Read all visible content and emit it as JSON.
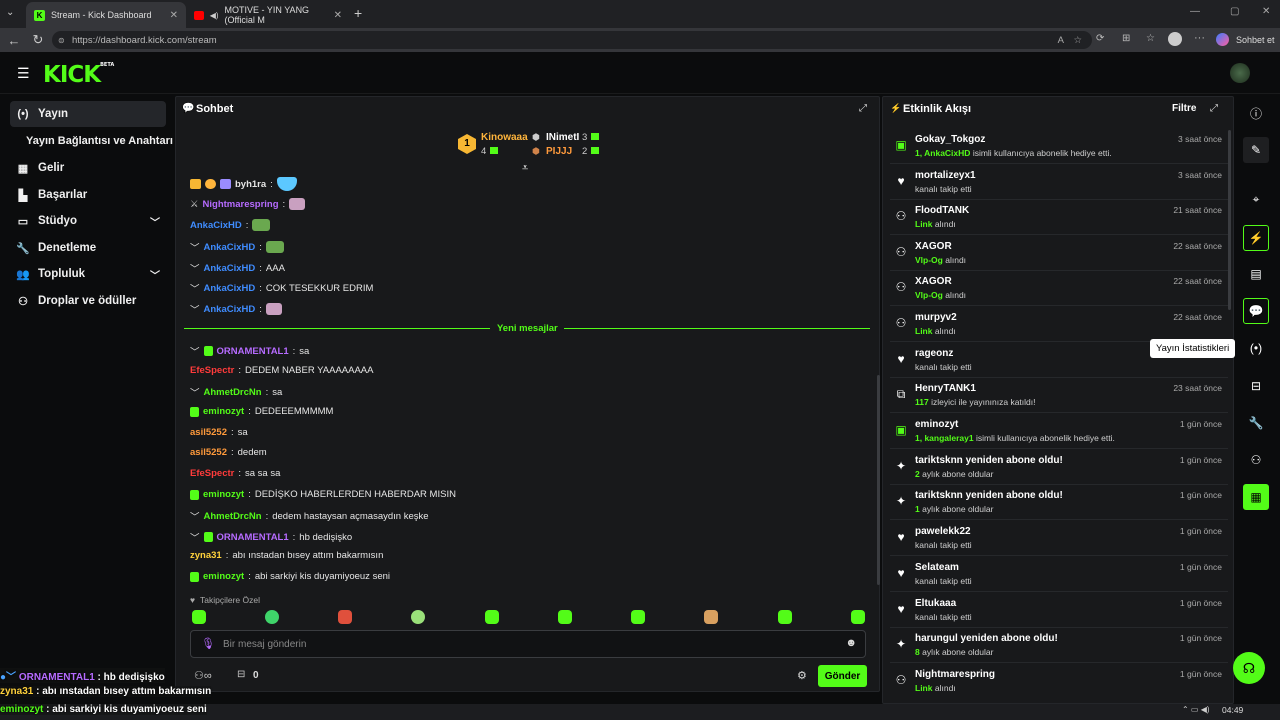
{
  "browser": {
    "tabs": [
      {
        "title": "Stream - Kick Dashboard"
      },
      {
        "title": "MOTIVE - YIN YANG (Official M"
      }
    ],
    "url": "https://dashboard.kick.com/stream",
    "copilot_label": "Sohbet et"
  },
  "app": {
    "logo": "KICK",
    "logo_badge": "BETA"
  },
  "sidebar": {
    "items": [
      {
        "label": "Yayın",
        "icon": "broadcast-icon"
      },
      {
        "label": "Yayın Bağlantısı ve Anahtarı",
        "icon": ""
      },
      {
        "label": "Gelir",
        "icon": "revenue-icon"
      },
      {
        "label": "Başarılar",
        "icon": "achievements-icon"
      },
      {
        "label": "Stüdyo",
        "icon": "studio-icon"
      },
      {
        "label": "Denetleme",
        "icon": "moderation-icon"
      },
      {
        "label": "Topluluk",
        "icon": "community-icon"
      },
      {
        "label": "Droplar ve ödüller",
        "icon": "drops-icon"
      }
    ]
  },
  "chat": {
    "title": "Sohbet",
    "leaderboard": [
      {
        "rank": "1",
        "name": "Kinowaaa",
        "count": "4"
      },
      {
        "name": "INimetI",
        "count": "3"
      },
      {
        "name": "PIJJJ",
        "count": "2"
      }
    ],
    "messages_old": [
      {
        "user": "byh1ra",
        "text": "",
        "color": "#e6e6e6"
      },
      {
        "user": "Nightmarespring",
        "text": "",
        "color": "#b66bff"
      },
      {
        "user": "AnkaCixHD",
        "text": "",
        "color": "#3f8cff"
      },
      {
        "user": "AnkaCixHD",
        "text": "",
        "color": "#3f8cff"
      },
      {
        "user": "AnkaCixHD",
        "text": "AAA",
        "color": "#3f8cff"
      },
      {
        "user": "AnkaCixHD",
        "text": "COK TESEKKUR EDRIM",
        "color": "#3f8cff"
      },
      {
        "user": "AnkaCixHD",
        "text": "",
        "color": "#3f8cff"
      }
    ],
    "new_messages_label": "Yeni mesajlar",
    "messages_new": [
      {
        "user": "ORNAMENTAL1",
        "text": "sa",
        "color": "#b66bff"
      },
      {
        "user": "EfeSpectr",
        "text": "DEDEM NABER YAAAAAAAA",
        "color": "#ff3b3b"
      },
      {
        "user": "AhmetDrcNn",
        "text": "sa",
        "color": "#53fc18"
      },
      {
        "user": "eminozyt",
        "text": "DEDEEEMMMMM",
        "color": "#53fc18"
      },
      {
        "user": "asil5252",
        "text": "sa",
        "color": "#ff9a3c"
      },
      {
        "user": "asil5252",
        "text": "dedem",
        "color": "#ff9a3c"
      },
      {
        "user": "EfeSpectr",
        "text": "sa sa sa",
        "color": "#ff3b3b"
      },
      {
        "user": "eminozyt",
        "text": "DEDİŞKO HABERLERDEN HABERDAR MISIN",
        "color": "#53fc18"
      },
      {
        "user": "AhmetDrcNn",
        "text": "dedem hastaysan açmasaydın keşke",
        "color": "#53fc18"
      },
      {
        "user": "ORNAMENTAL1",
        "text": "hb dedişişko",
        "color": "#b66bff"
      },
      {
        "user": "zyna31",
        "text": "abı ınstadan bısey attım bakarmısın",
        "color": "#ffd23c"
      },
      {
        "user": "eminozyt",
        "text": "abi sarkiyi kis duyamiyoeuz seni",
        "color": "#53fc18"
      }
    ],
    "followers_only_label": "Takipçilere Özel",
    "input_placeholder": "Bir mesaj gönderin",
    "points_value": "0",
    "send_label": "Gönder"
  },
  "activity": {
    "title": "Etkinlik Akışı",
    "filter_label": "Filtre",
    "items": [
      {
        "icon": "gift-icon",
        "name": "Gokay_Tokgoz",
        "desc_hl": "1, AnkaCixHD",
        "desc": "isimli kullanıcıya abonelik hediye etti.",
        "time": "3 saat önce"
      },
      {
        "icon": "heart-icon",
        "name": "mortalizeyx1",
        "desc_hl": "",
        "desc": "kanalı takip etti",
        "time": "3 saat önce"
      },
      {
        "icon": "drops-icon",
        "name": "FloodTANK",
        "desc_hl": "Link",
        "desc": "alındı",
        "time": "21 saat önce"
      },
      {
        "icon": "drops-icon",
        "name": "XAGOR",
        "desc_hl": "Vlp-Og",
        "desc": "alındı",
        "time": "22 saat önce"
      },
      {
        "icon": "drops-icon",
        "name": "XAGOR",
        "desc_hl": "Vlp-Og",
        "desc": "alındı",
        "time": "22 saat önce"
      },
      {
        "icon": "drops-icon",
        "name": "murpyv2",
        "desc_hl": "Link",
        "desc": "alındı",
        "time": "22 saat önce"
      },
      {
        "icon": "heart-icon",
        "name": "rageonz",
        "desc_hl": "",
        "desc": "kanalı takip etti",
        "time": ""
      },
      {
        "icon": "host-icon",
        "name": "HenryTANK1",
        "desc_hl": "117",
        "desc": "izleyici ile yayınınıza katıldı!",
        "time": "23 saat önce"
      },
      {
        "icon": "gift-icon",
        "name": "eminozyt",
        "desc_hl": "1, kangaleray1",
        "desc": "isimli kullanıcıya abonelik hediye etti.",
        "time": "1 gün önce"
      },
      {
        "icon": "sparkle-icon",
        "name": "tariktsknn yeniden abone oldu!",
        "desc_hl": "2",
        "desc": "aylık abone oldular",
        "time": "1 gün önce"
      },
      {
        "icon": "sparkle-icon",
        "name": "tariktsknn yeniden abone oldu!",
        "desc_hl": "1",
        "desc": "aylık abone oldular",
        "time": "1 gün önce"
      },
      {
        "icon": "heart-icon",
        "name": "pawelekk22",
        "desc_hl": "",
        "desc": "kanalı takip etti",
        "time": "1 gün önce"
      },
      {
        "icon": "heart-icon",
        "name": "Selateam",
        "desc_hl": "",
        "desc": "kanalı takip etti",
        "time": "1 gün önce"
      },
      {
        "icon": "heart-icon",
        "name": "Eltukaaa",
        "desc_hl": "",
        "desc": "kanalı takip etti",
        "time": "1 gün önce"
      },
      {
        "icon": "sparkle-icon",
        "name": "harungul yeniden abone oldu!",
        "desc_hl": "8",
        "desc": "aylık abone oldular",
        "time": "1 gün önce"
      },
      {
        "icon": "drops-icon",
        "name": "Nightmarespring",
        "desc_hl": "Link",
        "desc": "alındı",
        "time": "1 gün önce"
      }
    ]
  },
  "tooltip": "Yayın İstatistikleri",
  "overlay": [
    {
      "user": "ORNAMENTAL1",
      "text": " : hb dedişişko",
      "color": "#b66bff"
    },
    {
      "user": "zyna31",
      "text": " : abı ınstadan bısey attım bakarmısın",
      "color": "#ffd23c"
    },
    {
      "user": "eminozyt",
      "text": " : abi sarkiyi kis duyamiyoeuz seni",
      "color": "#53fc18"
    }
  ],
  "taskbar": {
    "time": "04:49"
  },
  "colors": {
    "brand": "#53fc18",
    "bg": "#0b0c0d",
    "panel": "#18191b"
  }
}
